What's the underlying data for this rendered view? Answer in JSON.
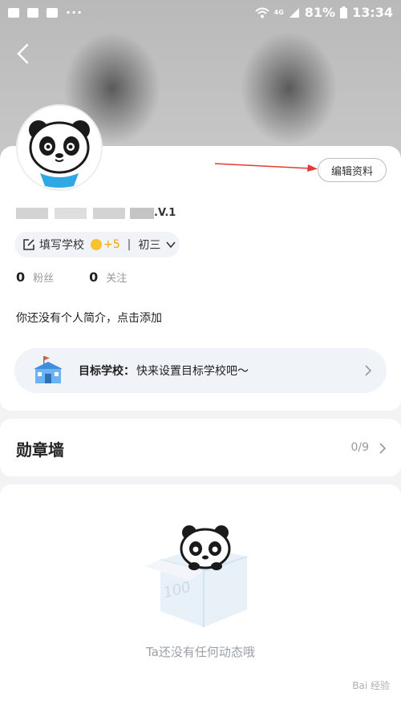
{
  "status_bar": {
    "battery": "81%",
    "time": "13:34",
    "more": "···",
    "network": "4G"
  },
  "profile": {
    "level": ".V.1",
    "edit_label": "编辑资料",
    "school_chip": {
      "label": "填写学校",
      "reward": "+5",
      "separator": "|",
      "grade": "初三"
    },
    "stats": [
      {
        "value": "0",
        "label": "粉丝"
      },
      {
        "value": "0",
        "label": "关注"
      }
    ],
    "bio": "你还没有个人简介，点击添加"
  },
  "target_school": {
    "label": "目标学校：",
    "value": "快来设置目标学校吧～"
  },
  "badge_wall": {
    "title": "勋章墙",
    "count": "0/9"
  },
  "feed": {
    "box_text": "100",
    "empty_text": "Ta还没有任何动态哦"
  },
  "watermark": "Bai 经验",
  "colors": {
    "accent_arrow": "#e53935",
    "coin": "#f7c32e",
    "chip_bg": "#f0f3f7"
  }
}
